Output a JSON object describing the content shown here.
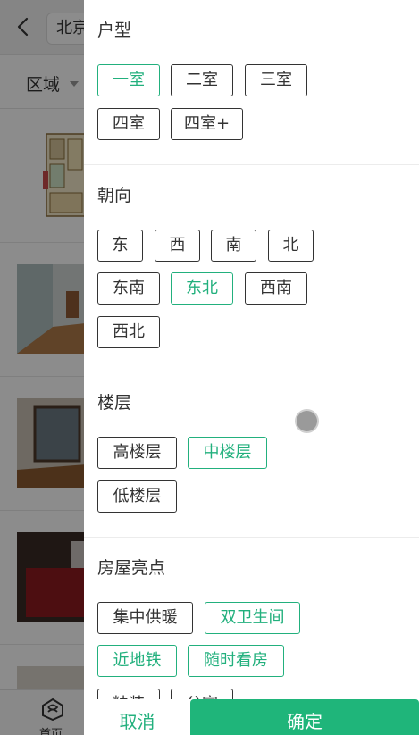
{
  "background": {
    "city_text": "北京",
    "area_filter_label": "区域",
    "home_tab_label": "首页"
  },
  "drawer": {
    "sections": [
      {
        "title": "户型",
        "options": [
          {
            "label": "一室",
            "selected": true
          },
          {
            "label": "二室",
            "selected": false
          },
          {
            "label": "三室",
            "selected": false
          },
          {
            "label": "四室",
            "selected": false
          },
          {
            "label": "四室+",
            "selected": false
          }
        ]
      },
      {
        "title": "朝向",
        "options": [
          {
            "label": "东",
            "selected": false
          },
          {
            "label": "西",
            "selected": false
          },
          {
            "label": "南",
            "selected": false
          },
          {
            "label": "北",
            "selected": false
          },
          {
            "label": "东南",
            "selected": false
          },
          {
            "label": "东北",
            "selected": true
          },
          {
            "label": "西南",
            "selected": false
          },
          {
            "label": "西北",
            "selected": false
          }
        ]
      },
      {
        "title": "楼层",
        "options": [
          {
            "label": "高楼层",
            "selected": false
          },
          {
            "label": "中楼层",
            "selected": true
          },
          {
            "label": "低楼层",
            "selected": false
          }
        ]
      },
      {
        "title": "房屋亮点",
        "options": [
          {
            "label": "集中供暖",
            "selected": false
          },
          {
            "label": "双卫生间",
            "selected": true
          },
          {
            "label": "近地铁",
            "selected": true
          },
          {
            "label": "随时看房",
            "selected": true
          },
          {
            "label": "精装",
            "selected": false
          },
          {
            "label": "公寓",
            "selected": false
          }
        ]
      }
    ],
    "footer": {
      "cancel_label": "取消",
      "confirm_label": "确定"
    }
  },
  "colors": {
    "accent": "#22b07d",
    "confirm_bg": "#1fb57a",
    "overlay": "rgba(0,0,0,0.45)"
  }
}
